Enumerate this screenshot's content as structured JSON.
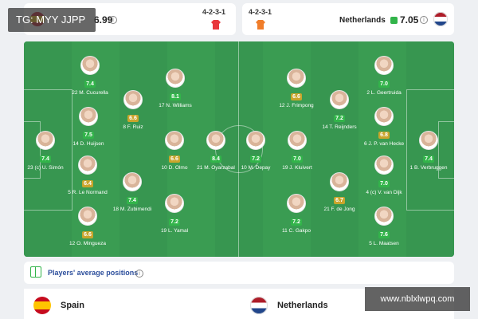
{
  "watermark_top": "TG: MYY JJPP",
  "watermark_bottom": "www.nblxlwpq.com",
  "header": {
    "home": {
      "rating": "6.99",
      "formation": "4-2-3-1",
      "kit_color": "#e8383d"
    },
    "away": {
      "name": "Netherlands",
      "rating": "7.05",
      "formation": "4-2-3-1",
      "kit_color": "#f07d2a"
    }
  },
  "colors": {
    "rating_high": "#32b44a",
    "rating_mid": "#c9a52c",
    "pitch": "#3a9c52"
  },
  "spain_players": [
    {
      "name": "M. Cucurella",
      "number": "22",
      "rating": "7.4"
    },
    {
      "name": "N. Williams",
      "number": "17",
      "rating": "8.1"
    },
    {
      "name": "F. Ruiz",
      "number": "8",
      "rating": "6.6"
    },
    {
      "name": "D. Huijsen",
      "number": "14",
      "rating": "7.5"
    },
    {
      "name": "U. Simón",
      "number": "23",
      "rating": "7.4",
      "captain": "(c)"
    },
    {
      "name": "D. Olmo",
      "number": "10",
      "rating": "6.6"
    },
    {
      "name": "M. Oyarzabal",
      "number": "21",
      "rating": "8.4"
    },
    {
      "name": "R. Le Normand",
      "number": "5",
      "rating": "6.4"
    },
    {
      "name": "M. Zubimendi",
      "number": "18",
      "rating": "7.4"
    },
    {
      "name": "L. Yamal",
      "number": "19",
      "rating": "7.2"
    },
    {
      "name": "O. Mingueza",
      "number": "12",
      "rating": "6.6"
    }
  ],
  "netherlands_players": [
    {
      "name": "J. Frimpong",
      "number": "12",
      "rating": "6.6"
    },
    {
      "name": "L. Geertruida",
      "number": "2",
      "rating": "7.0"
    },
    {
      "name": "T. Reijnders",
      "number": "14",
      "rating": "7.2"
    },
    {
      "name": "J. P. van Hecke",
      "number": "6",
      "rating": "6.8"
    },
    {
      "name": "M. Depay",
      "number": "10",
      "rating": "7.2"
    },
    {
      "name": "J. Kluivert",
      "number": "19",
      "rating": "7.0"
    },
    {
      "name": "B. Verbruggen",
      "number": "1",
      "rating": "7.4"
    },
    {
      "name": "V. van Dijk",
      "number": "4",
      "rating": "7.0",
      "captain": "(c)"
    },
    {
      "name": "F. de Jong",
      "number": "21",
      "rating": "6.7"
    },
    {
      "name": "C. Gakpo",
      "number": "11",
      "rating": "7.2"
    },
    {
      "name": "L. Maatsen",
      "number": "5",
      "rating": "7.6"
    }
  ],
  "average_positions_label": "Players' average positions",
  "teams": {
    "home": "Spain",
    "away": "Netherlands"
  }
}
